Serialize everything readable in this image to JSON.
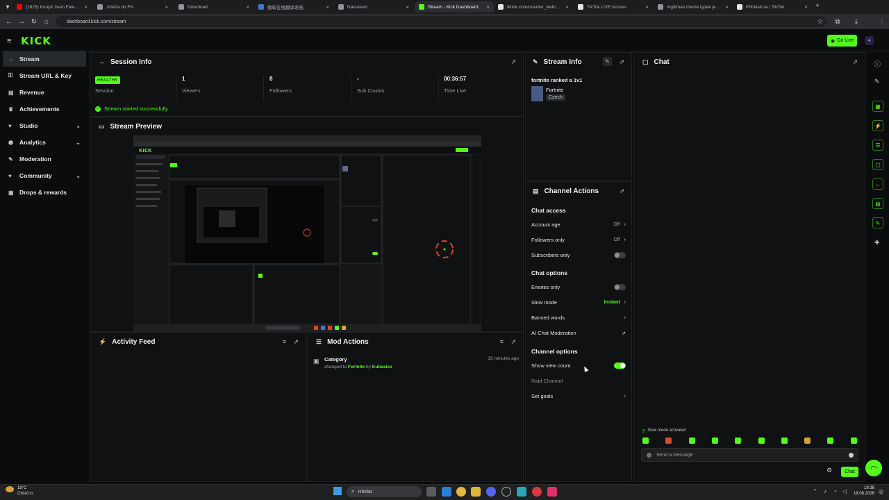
{
  "browser": {
    "tabs": [
      {
        "title": "(2825) Koupil Jsem Falešné Fo...",
        "color": "#ff0000"
      },
      {
        "title": "Jména do FN",
        "color": "#8f9499"
      },
      {
        "title": "Download",
        "color": "#8f9499"
      },
      {
        "title": "微软在线翻译系统",
        "color": "#3a78d8"
      },
      {
        "title": "Nastavení",
        "color": "#8f9499"
      },
      {
        "title": "Stream - Kick Dashboard",
        "color": "#53fc18"
      },
      {
        "title": "tiktok.com/ucenter_web/one...",
        "color": "#e5e5e5"
      },
      {
        "title": "TikTok LIVE Access",
        "color": "#e5e5e5"
      },
      {
        "title": "mgfilman meme typek je mo...",
        "color": "#8f9499"
      },
      {
        "title": "Přihlásit se | TikTok",
        "color": "#e5e5e5"
      }
    ],
    "url": "dashboard.kick.com/stream"
  },
  "header": {
    "logo": "KICK",
    "go_live": "Go Live"
  },
  "sidebar": {
    "items": [
      {
        "label": "Stream",
        "icon": "broadcast-icon",
        "active": true,
        "expandable": false
      },
      {
        "label": "Stream URL & Key",
        "icon": "key-icon",
        "active": false,
        "expandable": false
      },
      {
        "label": "Revenue",
        "icon": "revenue-icon",
        "active": false,
        "expandable": false
      },
      {
        "label": "Achievements",
        "icon": "trophy-icon",
        "active": false,
        "expandable": false
      },
      {
        "label": "Studio",
        "icon": "studio-icon",
        "active": false,
        "expandable": true
      },
      {
        "label": "Analytics",
        "icon": "analytics-icon",
        "active": false,
        "expandable": true
      },
      {
        "label": "Moderation",
        "icon": "wrench-icon",
        "active": false,
        "expandable": false
      },
      {
        "label": "Community",
        "icon": "community-icon",
        "active": false,
        "expandable": true
      },
      {
        "label": "Drops & rewards",
        "icon": "gift-icon",
        "active": false,
        "expandable": false
      }
    ]
  },
  "session": {
    "title": "Session Info",
    "status_badge": "HEALTHY",
    "stats": [
      {
        "value": "",
        "label": "Session"
      },
      {
        "value": "1",
        "label": "Viewers"
      },
      {
        "value": "8",
        "label": "Followers"
      },
      {
        "value": "-",
        "label": "Sub Counts"
      },
      {
        "value": "00:36:57",
        "label": "Time Live"
      }
    ],
    "message": "Stream started successfully."
  },
  "preview": {
    "title": "Stream Preview"
  },
  "activity": {
    "title": "Activity Feed"
  },
  "mod_actions": {
    "title": "Mod Actions",
    "entries": [
      {
        "title": "Category",
        "prefix": "changed to",
        "target": "Fortnite",
        "by": "by",
        "actor": "Kubasiss",
        "time": "35 minutes ago"
      }
    ]
  },
  "stream_info": {
    "title": "Stream Info",
    "stream_title": "fortnite ranked a 1v1",
    "category": "Fortnite",
    "language": "Czech"
  },
  "channel_actions": {
    "title": "Channel Actions",
    "chat_access": {
      "heading": "Chat access",
      "account_age": {
        "label": "Account age",
        "value": "Off"
      },
      "followers_only": {
        "label": "Followers only",
        "value": "Off"
      },
      "subscribers_only": {
        "label": "Subscribers only",
        "on": false
      }
    },
    "chat_options": {
      "heading": "Chat options",
      "emotes_only": {
        "label": "Emotes only",
        "on": false
      },
      "slow_mode": {
        "label": "Slow mode",
        "value": "Instant"
      },
      "banned_words": {
        "label": "Banned words"
      },
      "ai_moderation": {
        "label": "AI Chat Moderation"
      }
    },
    "channel_options": {
      "heading": "Channel options",
      "show_view_count": {
        "label": "Show view count",
        "on": true
      },
      "raid_channel": {
        "label": "Raid Channel"
      },
      "set_goals": {
        "label": "Set goals"
      }
    }
  },
  "chat": {
    "title": "Chat",
    "slow_mode_notice": "Slow mode activated",
    "input_placeholder": "Send a message",
    "send_label": "Chat",
    "emote_count": 10
  },
  "taskbar": {
    "weather_temp": "18°C",
    "weather_desc": "Oblačno",
    "search_placeholder": "Hledat",
    "time": "19:36",
    "date": "18.08.2026"
  }
}
